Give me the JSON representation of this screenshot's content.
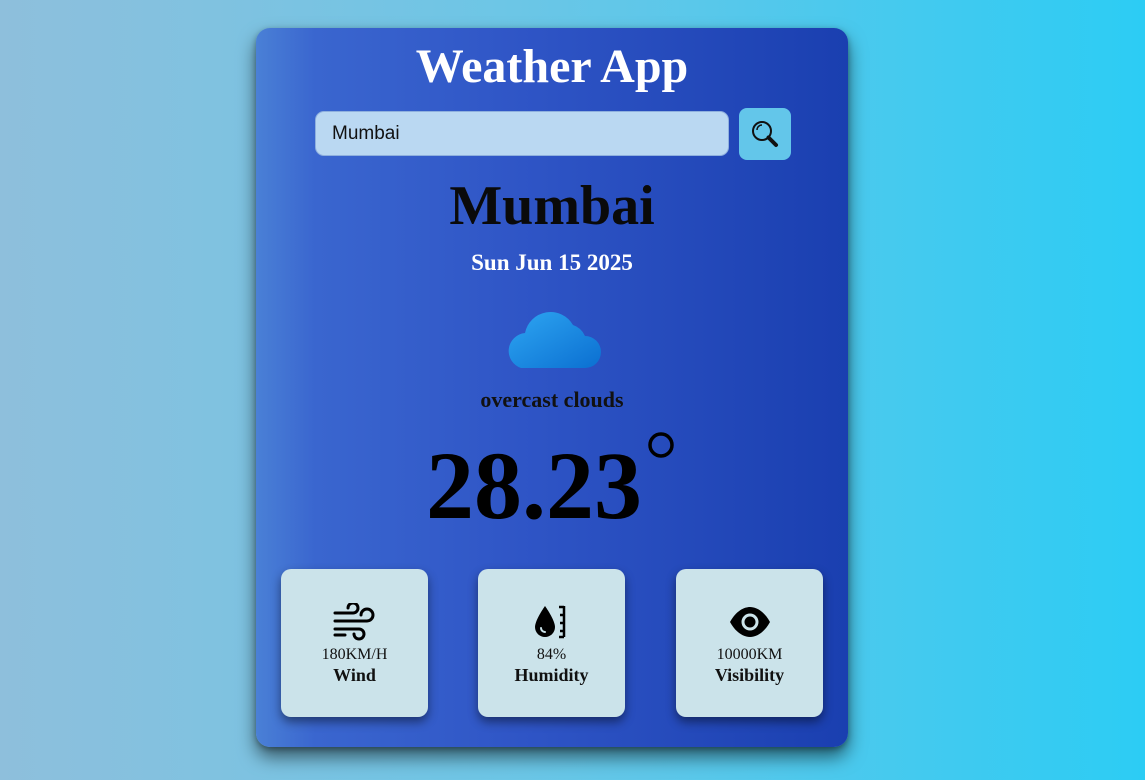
{
  "app": {
    "title": "Weather App"
  },
  "search": {
    "value": "Mumbai",
    "placeholder": ""
  },
  "weather": {
    "city": "Mumbai",
    "date": "Sun Jun 15 2025",
    "icon": "cloud-icon",
    "description": "overcast clouds",
    "temperature": "28.23"
  },
  "stats": [
    {
      "icon": "wind-icon",
      "value": "180KM/H",
      "label": "Wind"
    },
    {
      "icon": "humidity-icon",
      "value": "84%",
      "label": "Humidity"
    },
    {
      "icon": "eye-icon",
      "value": "10000KM",
      "label": "Visibility"
    }
  ],
  "colors": {
    "card_start": "#4a80d6",
    "card_end": "#1a3fb0",
    "search_bg": "#bad8f2",
    "search_button": "#63c6ea",
    "stat_bg": "#cbe3ea",
    "cloud": "#1e88e5"
  }
}
